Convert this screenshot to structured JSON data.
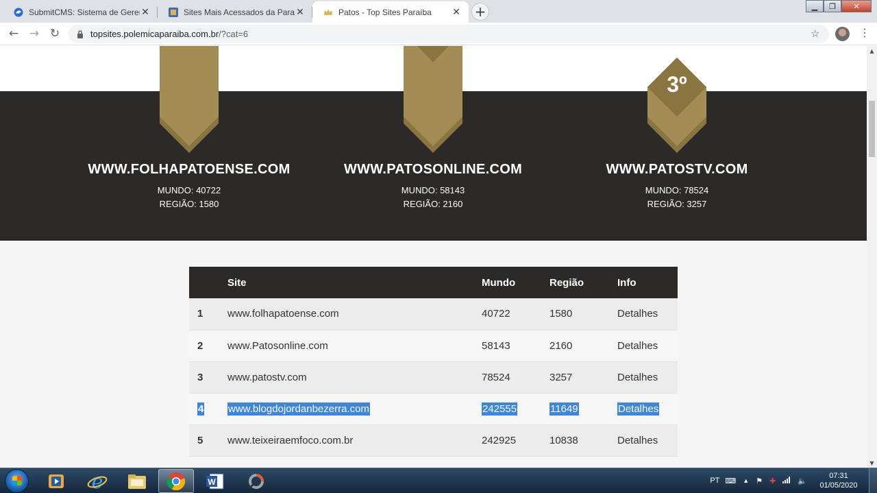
{
  "browser": {
    "tabs": [
      {
        "title": "SubmitCMS: Sistema de Gerencia",
        "icon": "submitcms-favicon-icon",
        "active": false
      },
      {
        "title": "Sites Mais Acessados da Paraíba",
        "icon": "sites-favicon-icon",
        "active": false
      },
      {
        "title": "Patos - Top Sites Paraíba",
        "icon": "crown-favicon-icon",
        "active": true
      }
    ],
    "new_tab_label": "+",
    "url_host": "topsites.polemicaparaiba.com.br",
    "url_path": "/?cat=6"
  },
  "winners": [
    {
      "site": "WWW.FOLHAPATOENSE.COM",
      "mundo": "MUNDO: 40722",
      "regiao": "REGIÃO: 1580",
      "place": ""
    },
    {
      "site": "WWW.PATOSONLINE.COM",
      "mundo": "MUNDO: 58143",
      "regiao": "REGIÃO: 2160",
      "place": ""
    },
    {
      "site": "WWW.PATOSTV.COM",
      "mundo": "MUNDO: 78524",
      "regiao": "REGIÃO: 3257",
      "place": "3º"
    }
  ],
  "ranking": {
    "headers": {
      "rank": "",
      "site": "Site",
      "mundo": "Mundo",
      "regiao": "Região",
      "info": "Info"
    },
    "rows": [
      {
        "rank": "1",
        "site": "www.folhapatoense.com",
        "mundo": "40722",
        "regiao": "1580",
        "info": "Detalhes",
        "selected": false
      },
      {
        "rank": "2",
        "site": "www.Patosonline.com",
        "mundo": "58143",
        "regiao": "2160",
        "info": "Detalhes",
        "selected": false
      },
      {
        "rank": "3",
        "site": "www.patostv.com",
        "mundo": "78524",
        "regiao": "3257",
        "info": "Detalhes",
        "selected": false
      },
      {
        "rank": "4",
        "site": "www.blogdojordanbezerra.com",
        "mundo": "242555",
        "regiao": "11649",
        "info": "Detalhes",
        "selected": true
      },
      {
        "rank": "5",
        "site": "www.teixeiraemfoco.com.br",
        "mundo": "242925",
        "regiao": "10838",
        "info": "Detalhes",
        "selected": false
      }
    ]
  },
  "taskbar": {
    "language": "PT",
    "time": "07:31",
    "date": "01/05/2020",
    "apps": [
      "start-button",
      "media-player-icon",
      "internet-explorer-icon",
      "file-explorer-icon",
      "chrome-icon",
      "word-icon",
      "sync-icon"
    ]
  },
  "colors": {
    "ribbon_gold": "#a38d55",
    "ribbon_dark_gold": "#8a7440",
    "dark_band": "#2b2a29",
    "selection": "#3d86e0"
  }
}
